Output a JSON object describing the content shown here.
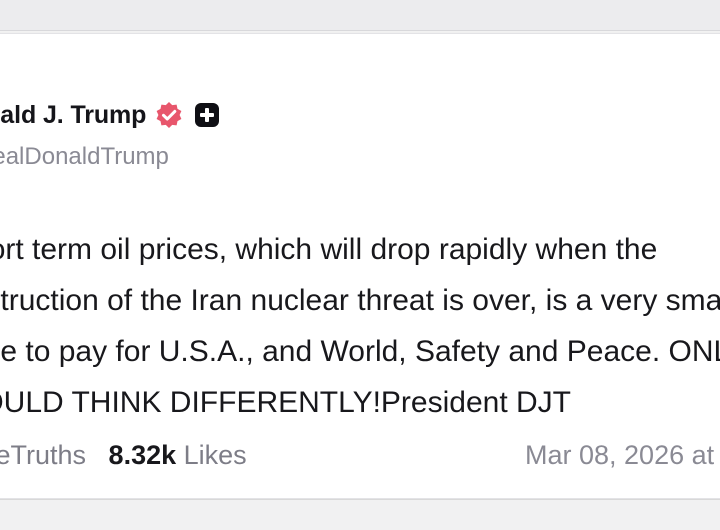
{
  "post": {
    "display_name": "Donald J. Trump",
    "handle": "@realDonaldTrump",
    "body_lines": [
      "Short term oil prices, which will drop rapidly when the",
      "destruction of the Iran nuclear threat is over, is a very small",
      "price to pay for U.S.A., and World, Safety and Peace. ONLY FOOLS",
      "WOULD THINK DIFFERENTLY!President DJT"
    ],
    "stats": {
      "retruths_count": "",
      "retruths_label": "ReTruths",
      "likes_count": "8.32k",
      "likes_label": "Likes"
    },
    "date": "Mar 08, 2026 at"
  },
  "icons": {
    "verified": "verified-badge-icon",
    "plus": "truth-plus-icon"
  },
  "colors": {
    "verified_badge": "#e8566c",
    "plus_badge": "#0f0f14",
    "primary_text": "#18181c",
    "secondary_text": "#8a8a94"
  }
}
